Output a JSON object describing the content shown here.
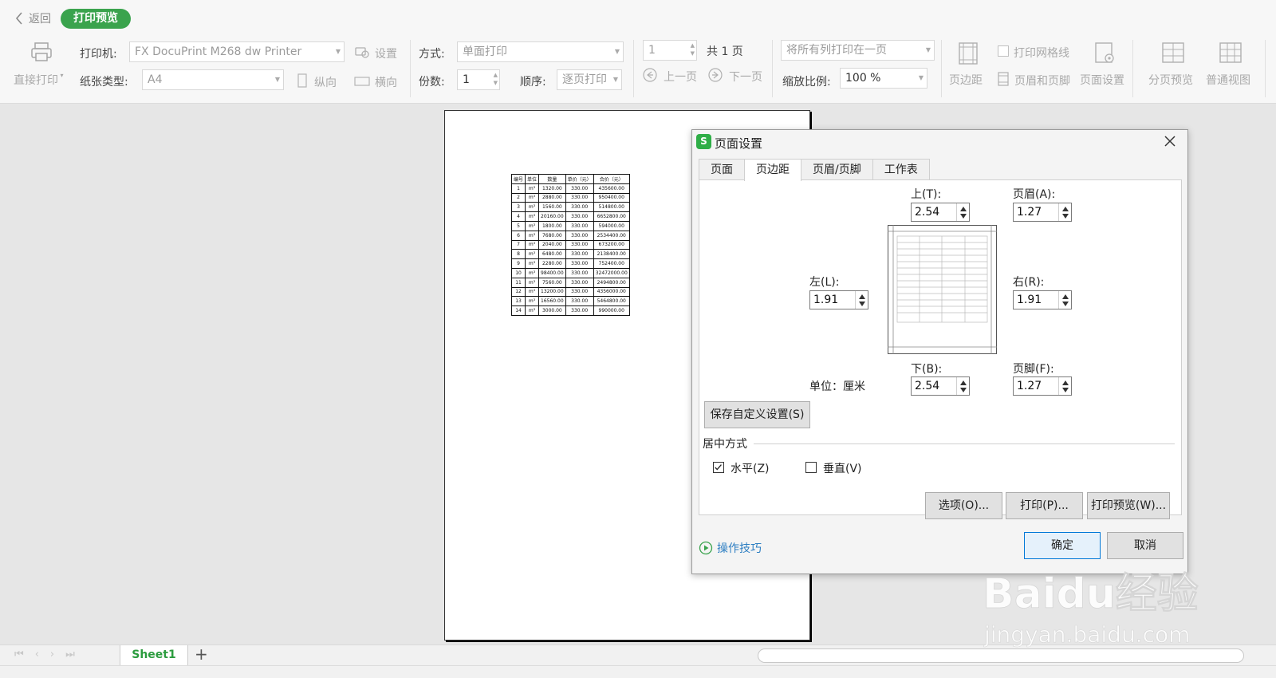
{
  "topbar": {
    "back_label": "返回",
    "mode_badge": "打印预览"
  },
  "toolbar": {
    "direct_print": "直接打印",
    "printer_label": "打印机:",
    "printer_value": "FX DocuPrint M268 dw Printer",
    "settings_label": "设置",
    "paper_label": "纸张类型:",
    "paper_value": "A4",
    "portrait_label": "纵向",
    "landscape_label": "横向",
    "mode_label": "方式:",
    "mode_value": "单面打印",
    "copies_label": "份数:",
    "copies_value": "1",
    "order_label": "顺序:",
    "order_value": "逐页打印",
    "page_value": "1",
    "total_pages": "共 1 页",
    "prev_page": "上一页",
    "next_page": "下一页",
    "fit_value": "将所有列打印在一页",
    "zoom_label": "缩放比例:",
    "zoom_value": "100 %",
    "margins_btn": "页边距",
    "print_gridlines": "打印网格线",
    "header_footer_btn": "页眉和页脚",
    "page_setup_btn": "页面设置",
    "page_break_btn": "分页预览",
    "normal_view_btn": "普通视图"
  },
  "preview_table": {
    "headers": [
      "编号",
      "单位",
      "数量",
      "单价（元）",
      "合价（元）"
    ],
    "rows": [
      [
        "1",
        "m³",
        "1320.00",
        "330.00",
        "435600.00"
      ],
      [
        "2",
        "m³",
        "2880.00",
        "330.00",
        "950400.00"
      ],
      [
        "3",
        "m³",
        "1560.00",
        "330.00",
        "514800.00"
      ],
      [
        "4",
        "m³",
        "20160.00",
        "330.00",
        "6652800.00"
      ],
      [
        "5",
        "m³",
        "1800.00",
        "330.00",
        "594000.00"
      ],
      [
        "6",
        "m³",
        "7680.00",
        "330.00",
        "2534400.00"
      ],
      [
        "7",
        "m³",
        "2040.00",
        "330.00",
        "673200.00"
      ],
      [
        "8",
        "m³",
        "6480.00",
        "330.00",
        "2138400.00"
      ],
      [
        "9",
        "m³",
        "2280.00",
        "330.00",
        "752400.00"
      ],
      [
        "10",
        "m³",
        "98400.00",
        "330.00",
        "32472000.00"
      ],
      [
        "11",
        "m³",
        "7560.00",
        "330.00",
        "2494800.00"
      ],
      [
        "12",
        "m³",
        "13200.00",
        "330.00",
        "4356000.00"
      ],
      [
        "13",
        "m³",
        "16560.00",
        "330.00",
        "5464800.00"
      ],
      [
        "14",
        "m³",
        "3000.00",
        "330.00",
        "990000.00"
      ]
    ]
  },
  "dialog": {
    "title": "页面设置",
    "tabs": [
      "页面",
      "页边距",
      "页眉/页脚",
      "工作表"
    ],
    "top_label": "上(T):",
    "top_value": "2.54",
    "header_label": "页眉(A):",
    "header_value": "1.27",
    "left_label": "左(L):",
    "left_value": "1.91",
    "right_label": "右(R):",
    "right_value": "1.91",
    "bottom_label": "下(B):",
    "bottom_value": "2.54",
    "footer_label": "页脚(F):",
    "footer_value": "1.27",
    "unit_label": "单位：厘米",
    "save_custom": "保存自定义设置(S)",
    "center_group": "居中方式",
    "horizontal_label": "水平(Z)",
    "horizontal_checked": true,
    "vertical_label": "垂直(V)",
    "vertical_checked": false,
    "options_btn": "选项(O)...",
    "print_btn": "打印(P)...",
    "print_preview_btn": "打印预览(W)...",
    "tips_label": "操作技巧",
    "ok_btn": "确定",
    "cancel_btn": "取消"
  },
  "sheetbar": {
    "sheet_name": "Sheet1",
    "add_label": "+"
  },
  "watermark": {
    "brand": "Baidu经验",
    "url": "jingyan.baidu.com"
  },
  "colors": {
    "accent_green": "#3aa34d",
    "primary_border": "#0078d7",
    "link_blue": "#2d7ec2"
  }
}
